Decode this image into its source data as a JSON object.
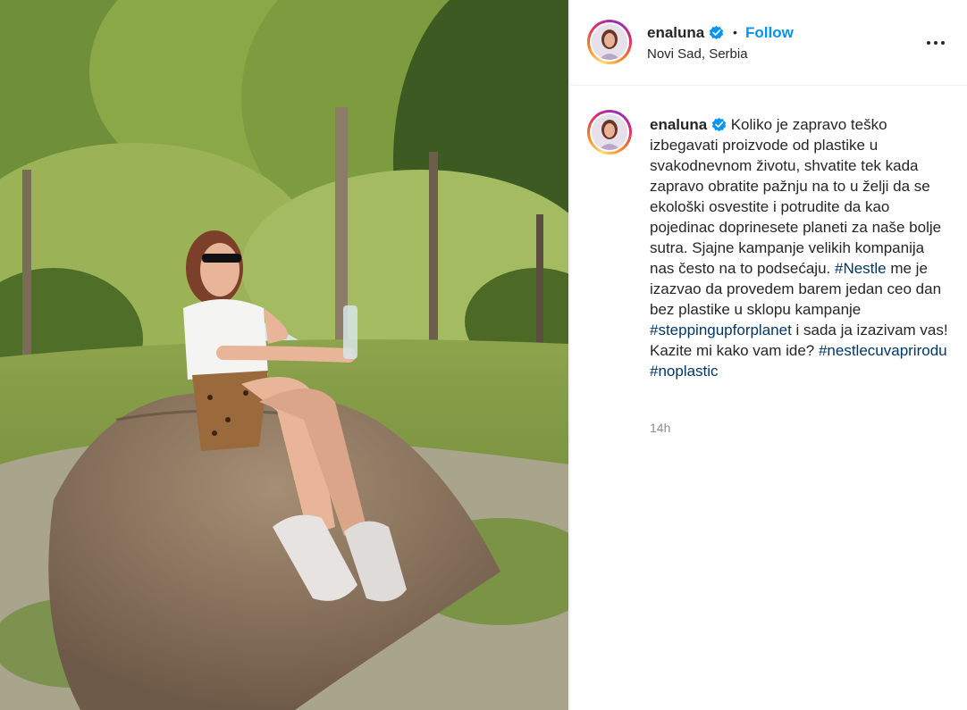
{
  "post": {
    "photo_icon": "photo-of-woman-sitting-on-tree-stump-in-park",
    "header": {
      "username": "enaluna",
      "separator": "•",
      "follow_label": "Follow",
      "location": "Novi Sad, Serbia",
      "more_icon": "more-options-icon"
    },
    "caption": {
      "username": "enaluna",
      "segments": [
        {
          "type": "text",
          "value": "Koliko je zapravo teško izbegavati proizvode od plastike u svakodnevnom životu, shvatite tek kada zapravo obratite pažnju na to u želji da se ekološki osvestite i potrudite da kao pojedinac doprinesete planeti za naše bolje sutra. Sjajne kampanje velikih kompanija nas često na to podsećaju. "
        },
        {
          "type": "link",
          "value": "#Nestle"
        },
        {
          "type": "text",
          "value": " me je izazvao da provedem barem jedan ceo dan bez plastike u sklopu kampanje "
        },
        {
          "type": "link",
          "value": "#steppingupforplanet"
        },
        {
          "type": "text",
          "value": " i sada ja izazivam vas! Kazite mi kako vam ide? "
        },
        {
          "type": "link",
          "value": "#nestlecuvaprirodu"
        },
        {
          "type": "text",
          "value": " "
        },
        {
          "type": "link",
          "value": "#noplastic"
        }
      ]
    },
    "time_ago": "14h"
  },
  "colors": {
    "link_blue": "#0095f6",
    "hashtag": "#00376b",
    "muted": "#8e8e8e",
    "verified": "#0095f6"
  }
}
